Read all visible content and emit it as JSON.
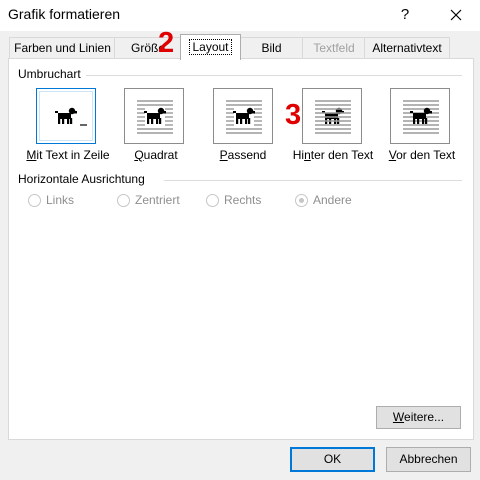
{
  "window": {
    "title": "Grafik formatieren",
    "help_glyph": "?"
  },
  "tabs": [
    {
      "label": "Farben und Linien",
      "state": "normal"
    },
    {
      "label": "Größe",
      "state": "normal"
    },
    {
      "label": "Layout",
      "state": "active"
    },
    {
      "label": "Bild",
      "state": "normal"
    },
    {
      "label": "Textfeld",
      "state": "disabled"
    },
    {
      "label": "Alternativtext",
      "state": "normal"
    }
  ],
  "wrap_section": {
    "title": "Umbruchart",
    "options": [
      {
        "label": "Mit Text in Zeile",
        "hotkey": "M",
        "rest": "it Text in Zeile",
        "selected": true
      },
      {
        "label": "Quadrat",
        "hotkey": "Q",
        "rest": "uadrat",
        "selected": false
      },
      {
        "label": "Passend",
        "hotkey": "P",
        "rest": "assend",
        "selected": false
      },
      {
        "label": "Hinter den Text",
        "pre": "Hi",
        "hotkey": "n",
        "rest": "ter den Text",
        "selected": false
      },
      {
        "label": "Vor den Text",
        "hotkey": "V",
        "rest": "or den Text",
        "selected": false
      }
    ]
  },
  "align_section": {
    "title": "Horizontale Ausrichtung",
    "options": [
      {
        "label": "Links",
        "checked": false
      },
      {
        "label": "Zentriert",
        "checked": false
      },
      {
        "label": "Rechts",
        "checked": false
      },
      {
        "label": "Andere",
        "checked": true
      }
    ]
  },
  "buttons": {
    "more": {
      "hotkey": "W",
      "rest": "eitere..."
    },
    "ok": "OK",
    "cancel": "Abbrechen"
  },
  "annotations": [
    "2",
    "3"
  ],
  "colors": {
    "accent": "#0078d7",
    "annotation": "#e00000"
  }
}
